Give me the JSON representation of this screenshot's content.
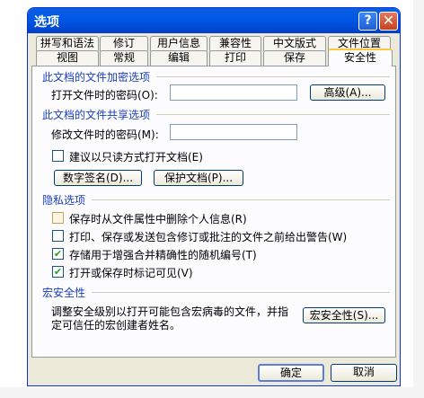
{
  "dialog": {
    "title": "选项",
    "help_glyph": "?",
    "close_glyph": "✕"
  },
  "tabs_top": [
    "拼写和语法",
    "修订",
    "用户信息",
    "兼容性",
    "中文版式",
    "文件位置"
  ],
  "tabs_bottom": [
    "视图",
    "常规",
    "编辑",
    "打印",
    "保存",
    "安全性"
  ],
  "encryption": {
    "title": "此文档的文件加密选项",
    "open_password_label": "打开文件时的密码(O):",
    "open_password_value": "",
    "advanced_button": "高级(A)..."
  },
  "sharing": {
    "title": "此文档的文件共享选项",
    "modify_password_label": "修改文件时的密码(M):",
    "modify_password_value": "",
    "read_only_label": "建议以只读方式打开文档(E)",
    "read_only_checked": false,
    "digital_signature_button": "数字签名(D)...",
    "protect_document_button": "保护文档(P)..."
  },
  "privacy": {
    "title": "隐私选项",
    "options": [
      {
        "label": "保存时从文件属性中删除个人信息(R)",
        "checked": false,
        "enabled": false
      },
      {
        "label": "打印、保存或发送包含修订或批注的文件之前给出警告(W)",
        "checked": false,
        "enabled": true
      },
      {
        "label": "存储用于增强合并精确性的随机编号(T)",
        "checked": true,
        "enabled": true
      },
      {
        "label": "打开或保存时标记可见(V)",
        "checked": true,
        "enabled": true
      }
    ]
  },
  "macro": {
    "title": "宏安全性",
    "description_line1": "调整安全级别以打开可能包含宏病毒的文件，并指",
    "description_line2": "定可信任的宏创建者姓名。",
    "macro_button": "宏安全性(S)..."
  },
  "footer": {
    "ok_button": "确定",
    "cancel_button": "取消"
  },
  "check_glyph": "✔"
}
